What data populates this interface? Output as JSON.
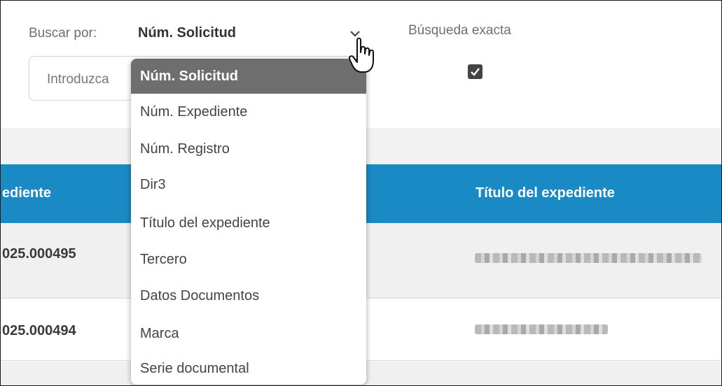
{
  "search": {
    "label": "Buscar por:",
    "selected": "Núm. Solicitud",
    "placeholder": "Introduzca",
    "exact_label": "Búsqueda exacta",
    "exact_checked": true
  },
  "dropdown": {
    "options": [
      "Núm. Solicitud",
      "Núm. Expediente",
      "Núm. Registro",
      "Dir3",
      "Título del expediente",
      "Tercero",
      "Datos Documentos",
      "Marca",
      "Serie documental"
    ],
    "selected_index": 0
  },
  "table": {
    "headers": [
      "ediente",
      "Título del expediente"
    ],
    "rows": [
      {
        "num": "025.000495"
      },
      {
        "num": "025.000494"
      }
    ]
  },
  "colors": {
    "header_bg": "#1a8ac4",
    "selected_option_bg": "#6e6e6e"
  }
}
